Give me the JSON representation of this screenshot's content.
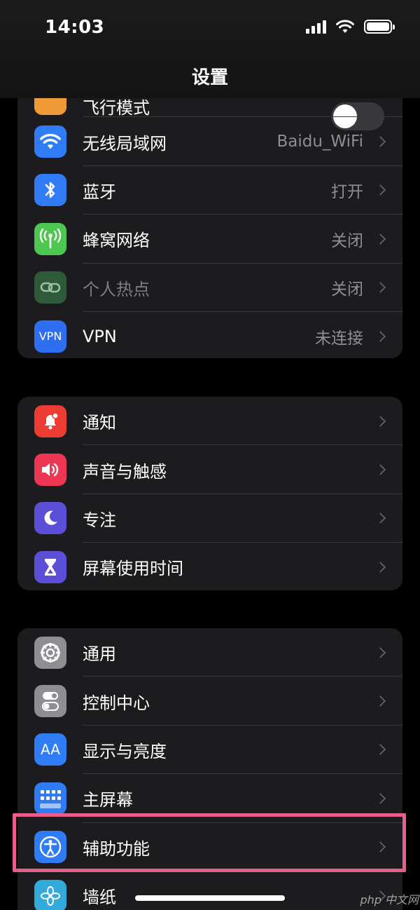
{
  "status_bar": {
    "time": "14:03"
  },
  "nav": {
    "title": "设置"
  },
  "group1": {
    "partial_row_label": "飞行模式",
    "items": [
      {
        "label": "无线局域网",
        "value": "Baidu_WiFi",
        "icon": "wifi-icon",
        "color": "#2f7cf6"
      },
      {
        "label": "蓝牙",
        "value": "打开",
        "icon": "bluetooth-icon",
        "color": "#2f7cf6"
      },
      {
        "label": "蜂窝网络",
        "value": "关闭",
        "icon": "antenna-icon",
        "color": "#4cc850"
      },
      {
        "label": "个人热点",
        "value": "关闭",
        "icon": "hotspot-chain-icon",
        "color": "#2f5a39"
      },
      {
        "label": "VPN",
        "value": "未连接",
        "icon": "vpn-icon",
        "icon_text": "VPN",
        "color": "#2d6ff0"
      }
    ]
  },
  "group2": {
    "items": [
      {
        "label": "通知",
        "icon": "notification-bell-icon",
        "color": "#ec3c34"
      },
      {
        "label": "声音与触感",
        "icon": "speaker-icon",
        "color": "#ef3654"
      },
      {
        "label": "专注",
        "icon": "moon-icon",
        "color": "#5a4fd6"
      },
      {
        "label": "屏幕使用时间",
        "icon": "hourglass-icon",
        "color": "#5a4fd6"
      }
    ]
  },
  "group3": {
    "items": [
      {
        "label": "通用",
        "icon": "gear-icon",
        "color": "#8e8e93"
      },
      {
        "label": "控制中心",
        "icon": "toggles-icon",
        "color": "#8e8e93"
      },
      {
        "label": "显示与亮度",
        "icon": "text-size-icon",
        "icon_text": "AA",
        "color": "#2f7cf6"
      },
      {
        "label": "主屏幕",
        "icon": "app-grid-icon",
        "color": "#2f7cf6"
      },
      {
        "label": "辅助功能",
        "icon": "accessibility-icon",
        "color": "#2f7cf6"
      },
      {
        "label": "墙纸",
        "icon": "flower-icon",
        "color": "#33aadc"
      }
    ]
  },
  "watermark": "php 中文网",
  "colors": {
    "accent": "#2f7cf6",
    "highlight": "#e8608a"
  }
}
